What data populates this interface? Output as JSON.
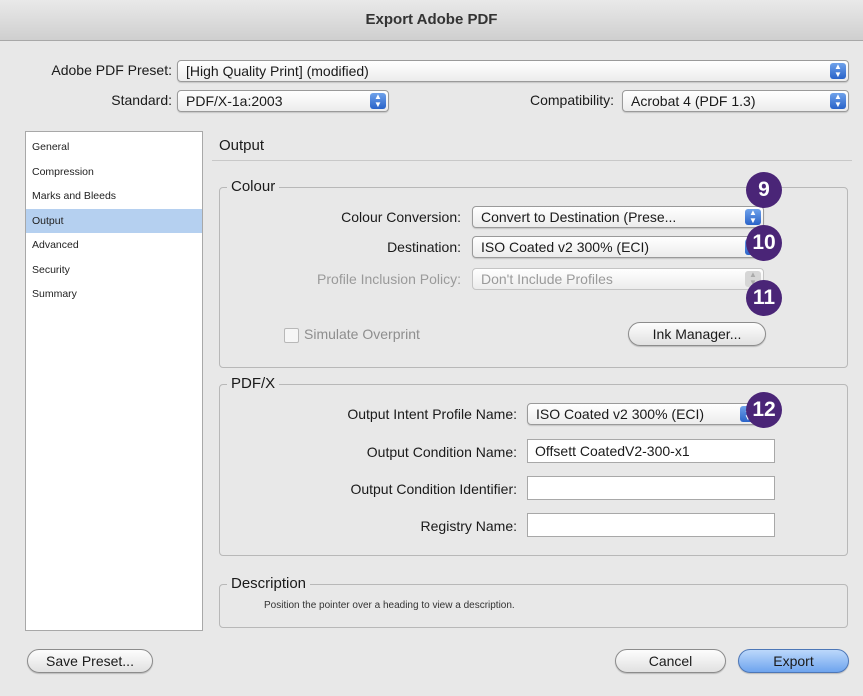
{
  "window": {
    "title": "Export Adobe PDF"
  },
  "header": {
    "preset_label": "Adobe PDF Preset:",
    "preset_value": "[High Quality Print] (modified)",
    "standard_label": "Standard:",
    "standard_value": "PDF/X-1a:2003",
    "compatibility_label": "Compatibility:",
    "compatibility_value": "Acrobat 4 (PDF 1.3)"
  },
  "sidebar": {
    "items": [
      {
        "label": "General"
      },
      {
        "label": "Compression"
      },
      {
        "label": "Marks and Bleeds"
      },
      {
        "label": "Output"
      },
      {
        "label": "Advanced"
      },
      {
        "label": "Security"
      },
      {
        "label": "Summary"
      }
    ],
    "selected": "Output"
  },
  "main": {
    "section_title": "Output",
    "colour": {
      "legend": "Colour",
      "conversion_label": "Colour Conversion:",
      "conversion_value": "Convert to Destination (Prese...",
      "destination_label": "Destination:",
      "destination_value": "ISO Coated v2 300% (ECI)",
      "profile_label": "Profile Inclusion Policy:",
      "profile_value": "Don't Include Profiles",
      "simulate_label": "Simulate Overprint",
      "ink_manager_label": "Ink Manager..."
    },
    "pdfx": {
      "legend": "PDF/X",
      "intent_label": "Output Intent Profile Name:",
      "intent_value": "ISO Coated v2 300% (ECI)",
      "condition_name_label": "Output Condition Name:",
      "condition_name_value": "Offsett CoatedV2-300-x1",
      "condition_id_label": "Output Condition Identifier:",
      "condition_id_value": "",
      "registry_label": "Registry Name:",
      "registry_value": ""
    },
    "description": {
      "legend": "Description",
      "text": "Position the pointer over a heading to view a description."
    }
  },
  "footer": {
    "save_preset_label": "Save Preset...",
    "cancel_label": "Cancel",
    "export_label": "Export"
  },
  "annotations": {
    "badge9": "9",
    "badge10": "10",
    "badge11": "11",
    "badge12": "12",
    "badge_color": "#4a2577"
  },
  "colors": {
    "selection": "#b5d0f0",
    "accent_button": "#6ea4ee",
    "stepper": "#2a63c9"
  }
}
